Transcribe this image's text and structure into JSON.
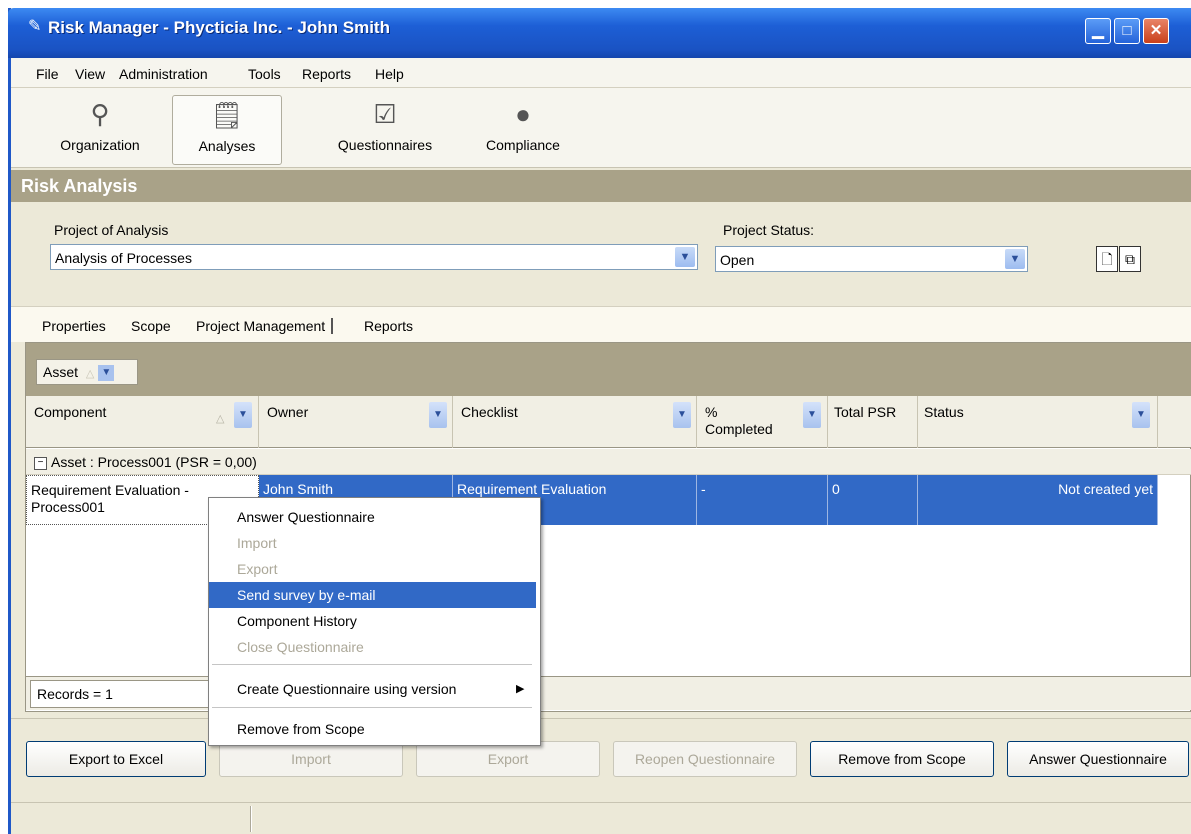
{
  "window": {
    "title": "Risk Manager - Phycticia Inc. - John Smith"
  },
  "menu": [
    "File",
    "View",
    "Administration",
    "Tools",
    "Reports",
    "Help"
  ],
  "toolbar": {
    "items": [
      {
        "label": "Organization",
        "icon": "org-chart-icon"
      },
      {
        "label": "Analyses",
        "icon": "analysis-icon"
      },
      {
        "label": "Questionnaires",
        "icon": "checklist-icon"
      },
      {
        "label": "Compliance",
        "icon": "compliance-icon"
      }
    ],
    "active": "Analyses"
  },
  "section": {
    "title": "Risk Analysis"
  },
  "form": {
    "project_label": "Project of Analysis",
    "project_value": "Analysis of Processes",
    "status_label": "Project Status:",
    "status_value": "Open"
  },
  "tabs": [
    "Properties",
    "Scope",
    "Project Management",
    "Reports"
  ],
  "grid": {
    "group_chip": "Asset",
    "columns": [
      "Component",
      "Owner",
      "Checklist",
      "% Completed",
      "Total PSR",
      "Status"
    ],
    "group_row": "Asset : Process001 (PSR = 0,00)",
    "rows": [
      {
        "component": "Requirement Evaluation - Process001",
        "owner": "John Smith",
        "checklist": "Requirement Evaluation",
        "completed": "-",
        "total_psr": "0",
        "status": "Not created yet"
      }
    ],
    "records": "Records = 1"
  },
  "context_menu": {
    "items": [
      {
        "label": "Answer Questionnaire",
        "enabled": true
      },
      {
        "label": "Import",
        "enabled": false
      },
      {
        "label": "Export",
        "enabled": false
      },
      {
        "label": "Send survey by e-mail",
        "enabled": true,
        "highlighted": true
      },
      {
        "label": "Component History",
        "enabled": true
      },
      {
        "label": "Close Questionnaire",
        "enabled": false
      },
      {
        "label": "Create Questionnaire using version",
        "enabled": true,
        "submenu": true
      },
      {
        "label": "Remove from Scope",
        "enabled": true
      }
    ]
  },
  "buttons": {
    "export_excel": "Export to Excel",
    "import": "Import",
    "export": "Export",
    "reopen": "Reopen Questionnaire",
    "remove_scope": "Remove from Scope",
    "answer": "Answer Questionnaire"
  },
  "colors": {
    "title_bar": "#1d5fd6",
    "section_header": "#a9a288",
    "selection": "#3169c6"
  }
}
